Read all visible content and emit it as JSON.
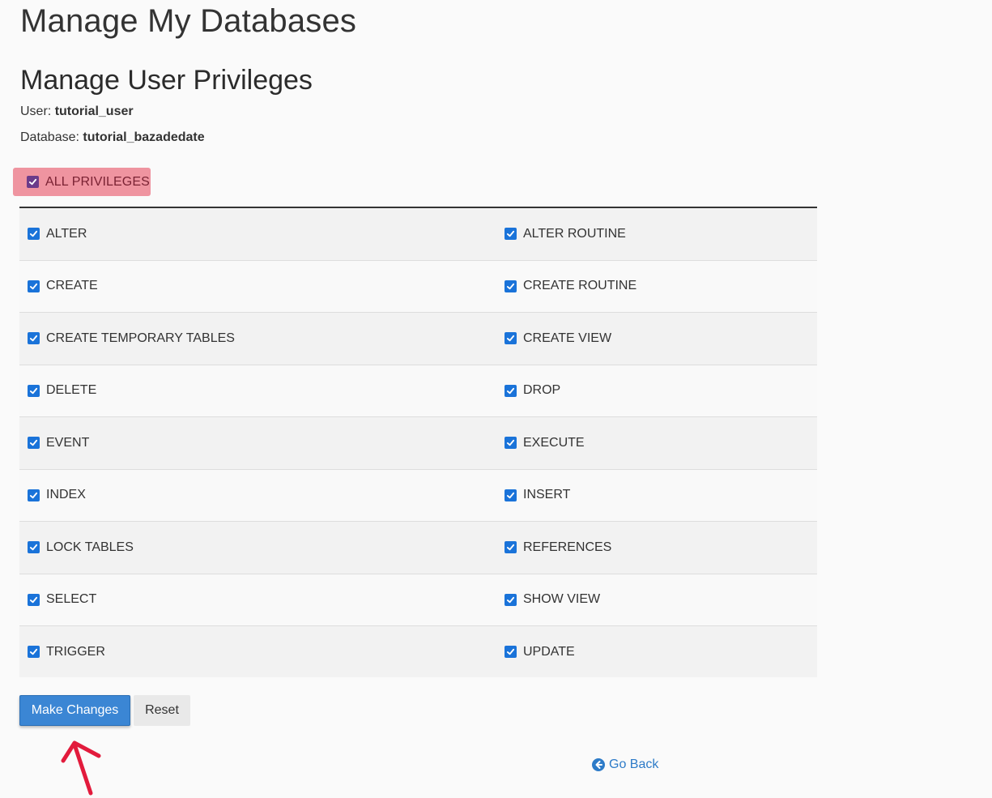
{
  "page": {
    "title": "Manage My Databases",
    "section_title": "Manage User Privileges"
  },
  "meta": {
    "user_label": "User:",
    "user_value": "tutorial_user",
    "db_label": "Database:",
    "db_value": "tutorial_bazadedate"
  },
  "all_privileges": {
    "label": "ALL PRIVILEGES",
    "checked": true
  },
  "privileges": [
    {
      "left": "ALTER",
      "right": "ALTER ROUTINE"
    },
    {
      "left": "CREATE",
      "right": "CREATE ROUTINE"
    },
    {
      "left": "CREATE TEMPORARY TABLES",
      "right": "CREATE VIEW"
    },
    {
      "left": "DELETE",
      "right": "DROP"
    },
    {
      "left": "EVENT",
      "right": "EXECUTE"
    },
    {
      "left": "INDEX",
      "right": "INSERT"
    },
    {
      "left": "LOCK TABLES",
      "right": "REFERENCES"
    },
    {
      "left": "SELECT",
      "right": "SHOW VIEW"
    },
    {
      "left": "TRIGGER",
      "right": "UPDATE"
    }
  ],
  "actions": {
    "make_changes": "Make Changes",
    "reset": "Reset",
    "go_back": "Go Back"
  },
  "icons": {
    "checkbox": "checkmark-icon",
    "go_back": "arrow-circle-left-icon",
    "annotation": "red-arrow-annotation-icon"
  },
  "colors": {
    "accent": "#1a73d9",
    "primary_button": "#3b86d4",
    "highlight": "#e85064",
    "link": "#2d7bc8"
  }
}
